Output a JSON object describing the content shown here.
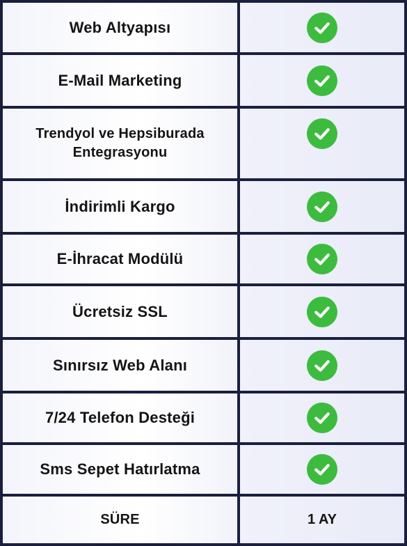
{
  "rows": [
    {
      "feature": "Web Altyapısı",
      "icon": "check-circle-icon"
    },
    {
      "feature": "E-Mail Marketing",
      "icon": "check-circle-icon"
    },
    {
      "feature": "Trendyol  ve Hepsiburada Entegrasyonu",
      "icon": "check-circle-icon"
    },
    {
      "feature": "İndirimli Kargo",
      "icon": "check-circle-icon"
    },
    {
      "feature": "E-İhracat Modülü",
      "icon": "check-circle-icon"
    },
    {
      "feature": "Ücretsiz SSL",
      "icon": "check-circle-icon"
    },
    {
      "feature": "Sınırsız Web Alanı",
      "icon": "check-circle-icon"
    },
    {
      "feature": "7/24 Telefon Desteği",
      "icon": "check-circle-icon"
    },
    {
      "feature": "Sms Sepet Hatırlatma",
      "icon": "check-circle-icon"
    }
  ],
  "duration": {
    "label": "SÜRE",
    "value": "1 AY"
  },
  "colors": {
    "border": "#1a1f3d",
    "check": "#3dbb3f"
  }
}
